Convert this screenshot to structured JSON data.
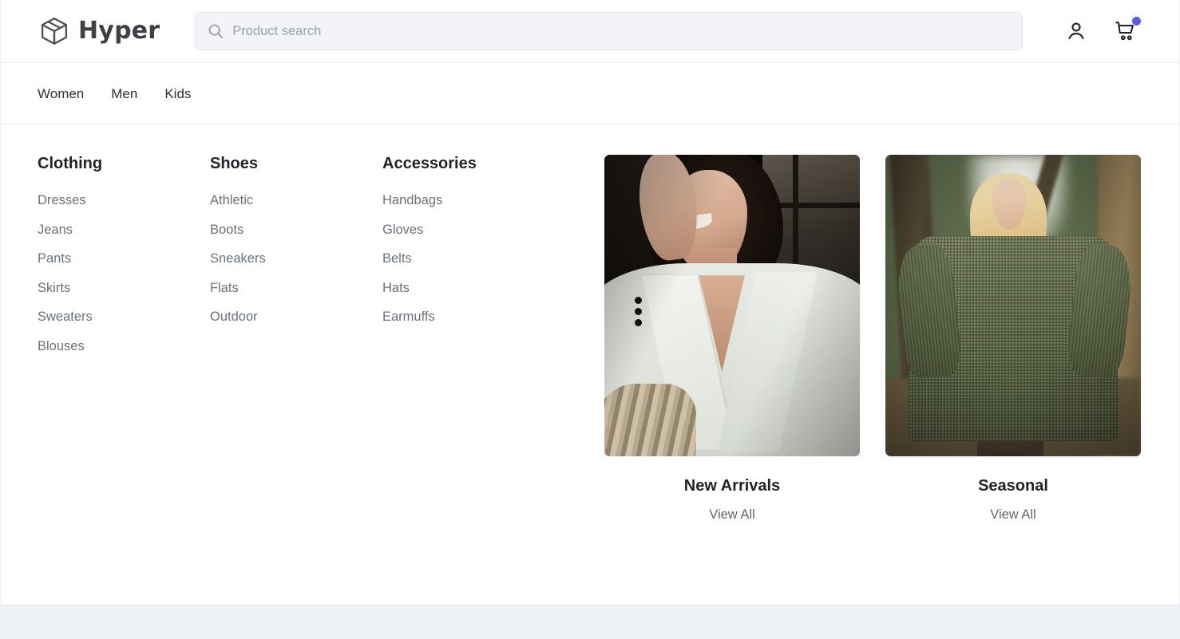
{
  "brand": {
    "name": "Hyper",
    "logo_icon": "cube-logo-icon"
  },
  "search": {
    "placeholder": "Product search",
    "value": "",
    "icon": "search-icon"
  },
  "header_actions": [
    {
      "icon": "account-person-icon",
      "name": "account-button",
      "badge": false
    },
    {
      "icon": "shopping-cart-icon",
      "name": "cart-button",
      "badge": true
    }
  ],
  "colors": {
    "cart_badge": "#5c5ce0",
    "page_background": "#eef1f5",
    "panel_background": "#ffffff",
    "divider": "#ededf0",
    "heading_text": "#1f2227",
    "link_text": "#6b7179"
  },
  "nav": {
    "items": [
      {
        "label": "Women"
      },
      {
        "label": "Men"
      },
      {
        "label": "Kids"
      }
    ]
  },
  "megamenu": {
    "columns": [
      {
        "title": "Clothing",
        "links": [
          "Dresses",
          "Jeans",
          "Pants",
          "Skirts",
          "Sweaters",
          "Blouses"
        ]
      },
      {
        "title": "Shoes",
        "links": [
          "Athletic",
          "Boots",
          "Sneakers",
          "Flats",
          "Outdoor"
        ]
      },
      {
        "title": "Accessories",
        "links": [
          "Handbags",
          "Gloves",
          "Belts",
          "Hats",
          "Earmuffs"
        ]
      }
    ],
    "promos": [
      {
        "title": "New Arrivals",
        "link_label": "View All",
        "image_alt": "Smiling woman in a cream blazer seated in a dark room"
      },
      {
        "title": "Seasonal",
        "link_label": "View All",
        "image_alt": "Blonde woman in an olive tweed blazer, white shirt and brown trousers outdoors"
      }
    ]
  }
}
